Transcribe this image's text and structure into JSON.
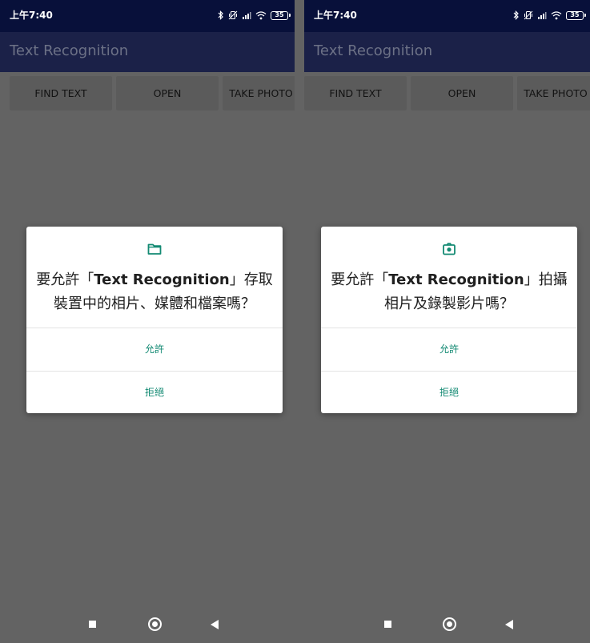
{
  "colors": {
    "status_bar": "#08103a",
    "app_bar": "#1b2148",
    "scrim": "#636363",
    "button_bg": "#5b5b5b",
    "dialog_bg": "#ffffff",
    "accent": "#138a73"
  },
  "screens": [
    {
      "status": {
        "time": "上午7:40",
        "battery": "35",
        "icons": [
          "bluetooth-icon",
          "vibrate-icon",
          "signal-icon",
          "wifi-icon",
          "battery-icon"
        ]
      },
      "app_title": "Text Recognition",
      "buttons": [
        "FIND TEXT",
        "OPEN",
        "TAKE PHOTO"
      ],
      "dialog": {
        "icon": "folder-icon",
        "message_prefix": "要允許「",
        "app_name": "Text Recognition",
        "message_suffix": "」存取裝置中的相片、媒體和檔案嗎？",
        "allow_label": "允許",
        "deny_label": "拒絕"
      }
    },
    {
      "status": {
        "time": "上午7:40",
        "battery": "35",
        "icons": [
          "bluetooth-icon",
          "vibrate-icon",
          "signal-icon",
          "wifi-icon",
          "battery-icon"
        ]
      },
      "app_title": "Text Recognition",
      "buttons": [
        "FIND TEXT",
        "OPEN",
        "TAKE PHOTO"
      ],
      "dialog": {
        "icon": "camera-icon",
        "message_prefix": "要允許「",
        "app_name": "Text Recognition",
        "message_suffix": "」拍攝相片及錄製影片嗎？",
        "allow_label": "允許",
        "deny_label": "拒絕"
      }
    }
  ],
  "navbar": {
    "icons": [
      "recents-square-icon",
      "home-circle-icon",
      "back-triangle-icon"
    ]
  }
}
